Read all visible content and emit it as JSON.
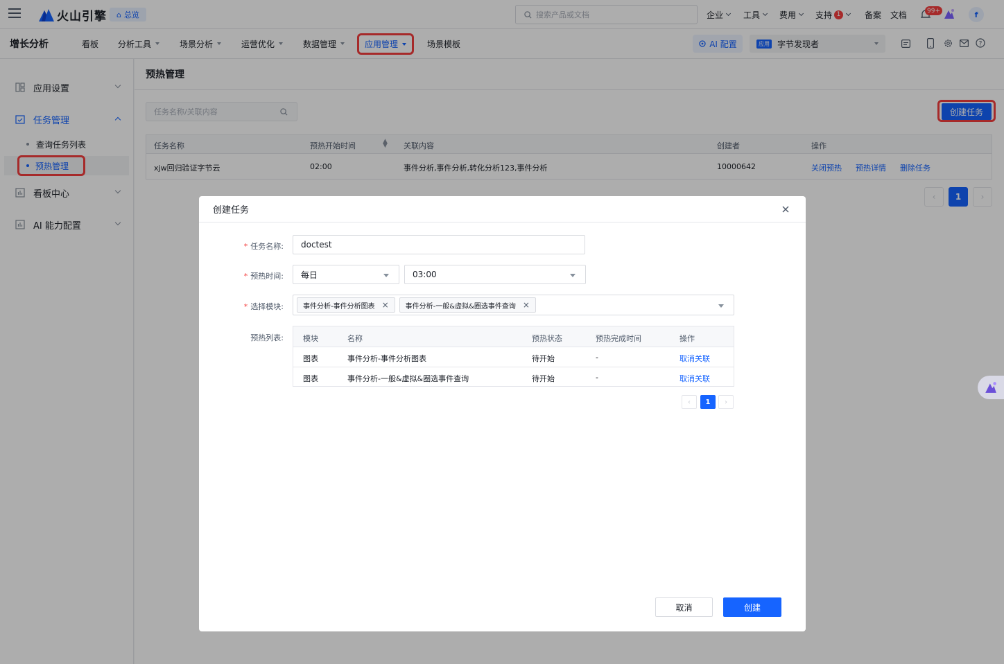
{
  "top": {
    "brand": "火山引擎",
    "overview": "总览",
    "search_placeholder": "搜索产品或文档",
    "menu": [
      "企业",
      "工具",
      "费用",
      "支持"
    ],
    "support_badge": "1",
    "filing": "备案",
    "docs": "文档",
    "notif_badge": "99+",
    "avatar": "f"
  },
  "subnav": {
    "brand": "增长分析",
    "items": [
      "看板",
      "分析工具",
      "场景分析",
      "运营优化",
      "数据管理",
      "应用管理",
      "场景模板"
    ],
    "ai": "AI 配置",
    "app_tag": "应用",
    "app_name": "字节发现者"
  },
  "sidebar": {
    "groups": [
      "应用设置",
      "任务管理",
      "看板中心",
      "AI 能力配置"
    ],
    "items": [
      "查询任务列表",
      "预热管理"
    ]
  },
  "page": {
    "title": "预热管理",
    "search_placeholder": "任务名称/关联内容",
    "create_button": "创建任务",
    "table": {
      "headers": [
        "任务名称",
        "预热开始时间",
        "关联内容",
        "创建者",
        "操作"
      ],
      "rows": [
        {
          "name": "xjw回归验证字节云",
          "time": "02:00",
          "content": "事件分析,事件分析,转化分析123,事件分析",
          "creator": "10000642",
          "actions": [
            "关闭预热",
            "预热详情",
            "删除任务"
          ]
        }
      ]
    },
    "pagination": {
      "current": "1"
    }
  },
  "modal": {
    "title": "创建任务",
    "labels": {
      "name": "任务名称:",
      "time": "预热时间:",
      "module": "选择模块:",
      "list": "预热列表:"
    },
    "required_mark": "*",
    "name_value": "doctest",
    "frequency": "每日",
    "time_value": "03:00",
    "chips": [
      "事件分析-事件分析图表",
      "事件分析-一般&虚拟&圈选事件查询"
    ],
    "table": {
      "headers": [
        "模块",
        "名称",
        "预热状态",
        "预热完成时间",
        "操作"
      ],
      "rows": [
        {
          "module": "图表",
          "name": "事件分析-事件分析图表",
          "status": "待开始",
          "done": "-",
          "action": "取消关联"
        },
        {
          "module": "图表",
          "name": "事件分析-一般&虚拟&圈选事件查询",
          "status": "待开始",
          "done": "-",
          "action": "取消关联"
        }
      ]
    },
    "pagination": {
      "current": "1"
    },
    "cancel": "取消",
    "create": "创建"
  },
  "colors": {
    "primary": "#1664ff",
    "highlight": "#f53f3f"
  }
}
